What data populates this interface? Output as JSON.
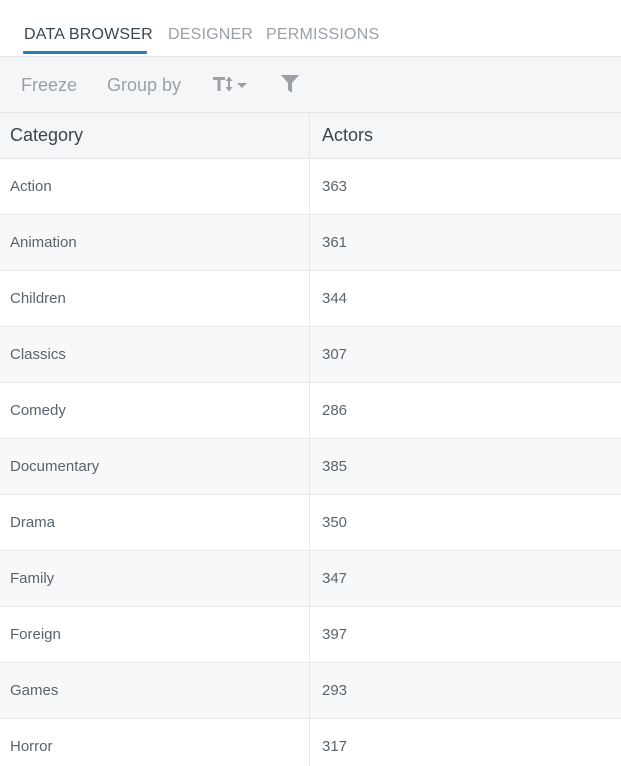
{
  "tabs": [
    {
      "label": "DATA BROWSER",
      "active": true
    },
    {
      "label": "DESIGNER",
      "active": false
    },
    {
      "label": "PERMISSIONS",
      "active": false
    }
  ],
  "toolbar": {
    "freeze_label": "Freeze",
    "group_by_label": "Group by",
    "sort_icon": "text-size-sort-icon",
    "filter_icon": "filter-funnel-icon"
  },
  "table": {
    "columns": [
      "Category",
      "Actors"
    ],
    "rows": [
      [
        "Action",
        "363"
      ],
      [
        "Animation",
        "361"
      ],
      [
        "Children",
        "344"
      ],
      [
        "Classics",
        "307"
      ],
      [
        "Comedy",
        "286"
      ],
      [
        "Documentary",
        "385"
      ],
      [
        "Drama",
        "350"
      ],
      [
        "Family",
        "347"
      ],
      [
        "Foreign",
        "397"
      ],
      [
        "Games",
        "293"
      ],
      [
        "Horror",
        "317"
      ]
    ]
  },
  "colors": {
    "accent": "#2b7bb9",
    "text_muted": "#9aa0a6",
    "text_dark": "#3a4550"
  }
}
